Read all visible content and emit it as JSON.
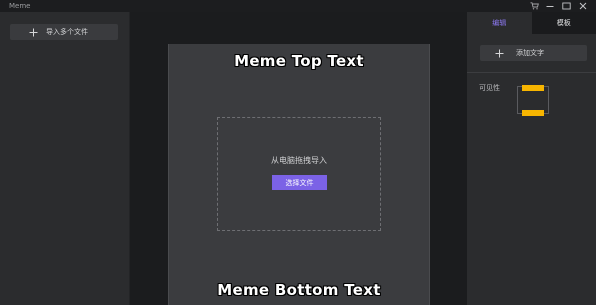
{
  "window": {
    "title": "Meme"
  },
  "left_panel": {
    "import_label": "导入多个文件"
  },
  "canvas": {
    "top_text": "Meme Top Text",
    "bottom_text": "Meme Bottom Text",
    "drop_hint": "从电脑拖拽导入",
    "choose_file_label": "选择文件"
  },
  "right_panel": {
    "tabs": [
      {
        "label": "编辑",
        "active": true
      },
      {
        "label": "模板",
        "active": false
      }
    ],
    "add_text_label": "添加文字",
    "visibility_label": "可见性"
  },
  "colors": {
    "accent": "#7b62e6",
    "tab_active_text": "#8d79f2",
    "visibility_bar": "#f7b500"
  },
  "icons": {
    "titlebar": [
      "cart-icon",
      "minimize-icon",
      "maximize-icon",
      "close-icon"
    ],
    "buttons": [
      "plus-icon"
    ]
  }
}
